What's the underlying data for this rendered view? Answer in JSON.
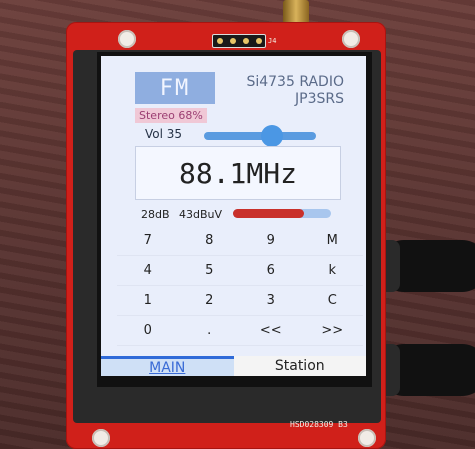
{
  "device": {
    "header_label": "J4",
    "model": "HSD028309   B3"
  },
  "display": {
    "band": "FM",
    "title_line1": "Si4735 RADIO",
    "title_line2": "JP3SRS",
    "stereo": "Stereo 68%",
    "volume_label": "Vol 35",
    "volume_level": 0.6,
    "frequency": "88.1MHz",
    "snr": "28dB",
    "rssi": "43dBuV",
    "signal_level": 0.72,
    "colors": {
      "background": "#e9eefb",
      "accent": "#4b97e4",
      "signal": "#c9302b"
    }
  },
  "keypad": {
    "rows": [
      [
        "7",
        "8",
        "9",
        "M"
      ],
      [
        "4",
        "5",
        "6",
        "k"
      ],
      [
        "1",
        "2",
        "3",
        "C"
      ],
      [
        "0",
        ".",
        "<<",
        ">>"
      ]
    ]
  },
  "tabs": {
    "main": "MAIN",
    "station": "Station"
  }
}
